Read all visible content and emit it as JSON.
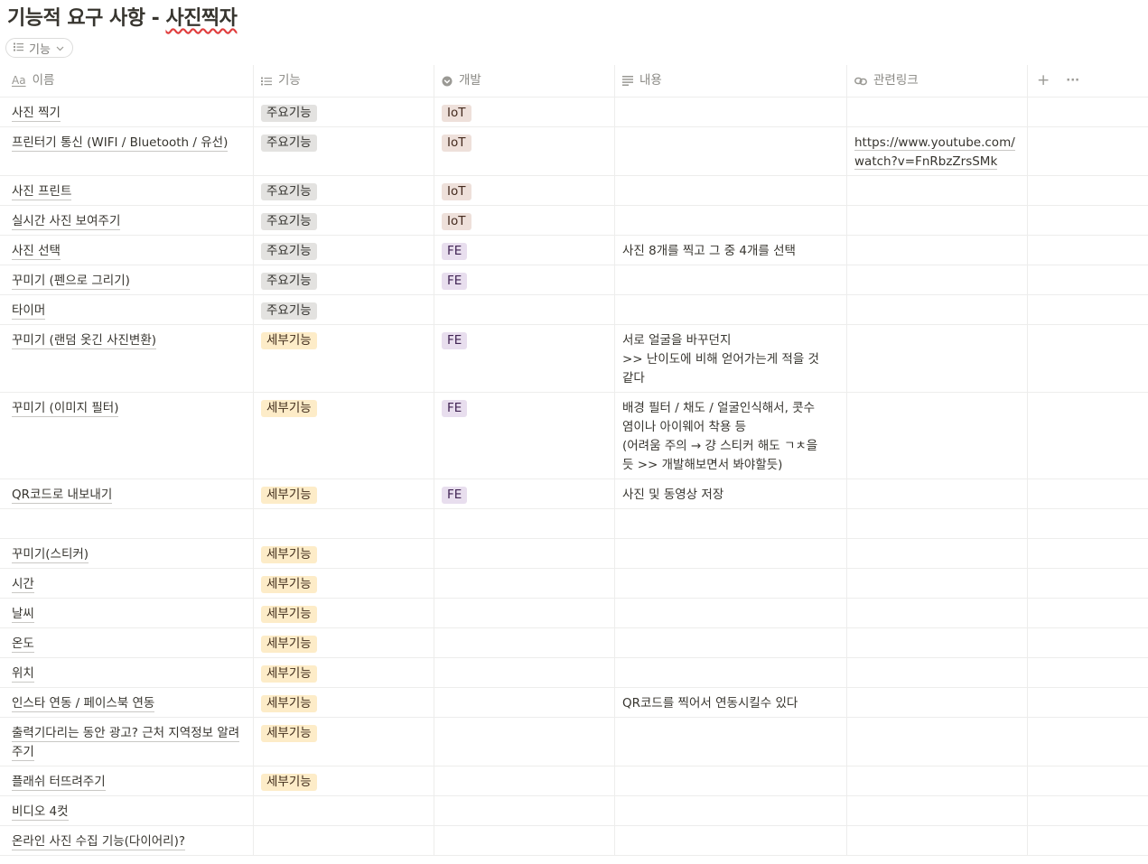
{
  "page": {
    "title_prefix": "기능적 요구 사항 - ",
    "title_underlined": "사진찍자"
  },
  "view": {
    "label": "기능"
  },
  "columns": [
    {
      "label": "이름",
      "icon": "Aa",
      "icon_name": "text-property-icon"
    },
    {
      "label": "기능",
      "icon_name": "list-property-icon"
    },
    {
      "label": "개발",
      "icon_name": "select-property-icon"
    },
    {
      "label": "내용",
      "icon_name": "text-lines-property-icon"
    },
    {
      "label": "관련링크",
      "icon_name": "link-property-icon"
    }
  ],
  "header_actions": {
    "add": "+",
    "more": "···"
  },
  "tag_colors": {
    "주요기능": {
      "bg": "#e3e2e0",
      "fg": "#32302c"
    },
    "세부기능": {
      "bg": "#fdecc8",
      "fg": "#402c1b"
    },
    "IoT": {
      "bg": "#eee0da",
      "fg": "#442a1e"
    },
    "FE": {
      "bg": "#e8deee",
      "fg": "#412454"
    }
  },
  "rows": [
    {
      "name": "사진 찍기",
      "func": "주요기능",
      "dev": "IoT",
      "content": [],
      "link": "",
      "h": 33
    },
    {
      "name": "프린터기 통신 (WIFI / Bluetooth / 유선)",
      "func": "주요기능",
      "dev": "IoT",
      "content": [],
      "link": "https://www.youtube.com/watch?v=FnRbzZrsSMk",
      "h": 54
    },
    {
      "name": "사진 프린트",
      "func": "주요기능",
      "dev": "IoT",
      "content": [],
      "link": "",
      "h": 33
    },
    {
      "name": "실시간 사진 보여주기",
      "func": "주요기능",
      "dev": "IoT",
      "content": [],
      "link": "",
      "h": 33
    },
    {
      "name": "사진 선택",
      "func": "주요기능",
      "dev": "FE",
      "content": [
        "사진 8개를 찍고 그 중 4개를 선택"
      ],
      "link": "",
      "h": 33
    },
    {
      "name": "꾸미기 (펜으로 그리기)",
      "func": "주요기능",
      "dev": "FE",
      "content": [],
      "link": "",
      "h": 33
    },
    {
      "name": "타이머",
      "func": "주요기능",
      "dev": "",
      "content": [],
      "link": "",
      "h": 33
    },
    {
      "name": "꾸미기 (랜덤 옷긴 사진변환)",
      "func": "세부기능",
      "dev": "FE",
      "content": [
        "서로 얼굴을 바꾸던지",
        ">> 난이도에 비해 얻어가는게 적을 것",
        "같다"
      ],
      "link": "",
      "h": 75
    },
    {
      "name": "꾸미기 (이미지 필터)",
      "func": "세부기능",
      "dev": "FE",
      "content": [
        "배경 필터 / 채도 / 얼굴인식해서, 콧수",
        "염이나 아이웨어 착용 등",
        "(어려움 주의 → 걍 스티커 해도 ㄱㅊ을",
        "듯 >> 개발해보면서 봐야할듯)"
      ],
      "link": "",
      "h": 96
    },
    {
      "name": "QR코드로 내보내기",
      "func": "세부기능",
      "dev": "FE",
      "content": [
        "사진 및 동영상 저장"
      ],
      "link": "",
      "h": 33
    },
    {
      "name": "",
      "func": "",
      "dev": "",
      "content": [],
      "link": "",
      "h": 33
    },
    {
      "name": "꾸미기(스티커)",
      "func": "세부기능",
      "dev": "",
      "content": [],
      "link": "",
      "h": 33
    },
    {
      "name": "시간",
      "func": "세부기능",
      "dev": "",
      "content": [],
      "link": "",
      "h": 33
    },
    {
      "name": "날씨",
      "func": "세부기능",
      "dev": "",
      "content": [],
      "link": "",
      "h": 33
    },
    {
      "name": "온도",
      "func": "세부기능",
      "dev": "",
      "content": [],
      "link": "",
      "h": 33
    },
    {
      "name": "위치",
      "func": "세부기능",
      "dev": "",
      "content": [],
      "link": "",
      "h": 33
    },
    {
      "name": "인스타 연동 / 페이스북 연동",
      "func": "세부기능",
      "dev": "",
      "content": [
        "QR코드를 찍어서 연동시킬수 있다"
      ],
      "link": "",
      "h": 33
    },
    {
      "name": "출력기다리는 동안 광고? 근처 지역정보 알려주기",
      "func": "세부기능",
      "dev": "",
      "content": [],
      "link": "",
      "h": 54
    },
    {
      "name": "플래쉬 터뜨려주기",
      "func": "세부기능",
      "dev": "",
      "content": [],
      "link": "",
      "h": 33
    },
    {
      "name": "비디오 4컷",
      "func": "",
      "dev": "",
      "content": [],
      "link": "",
      "h": 33
    },
    {
      "name": "온라인 사진 수집 기능(다이어리)?",
      "func": "",
      "dev": "",
      "content": [],
      "link": "",
      "h": 33
    }
  ]
}
